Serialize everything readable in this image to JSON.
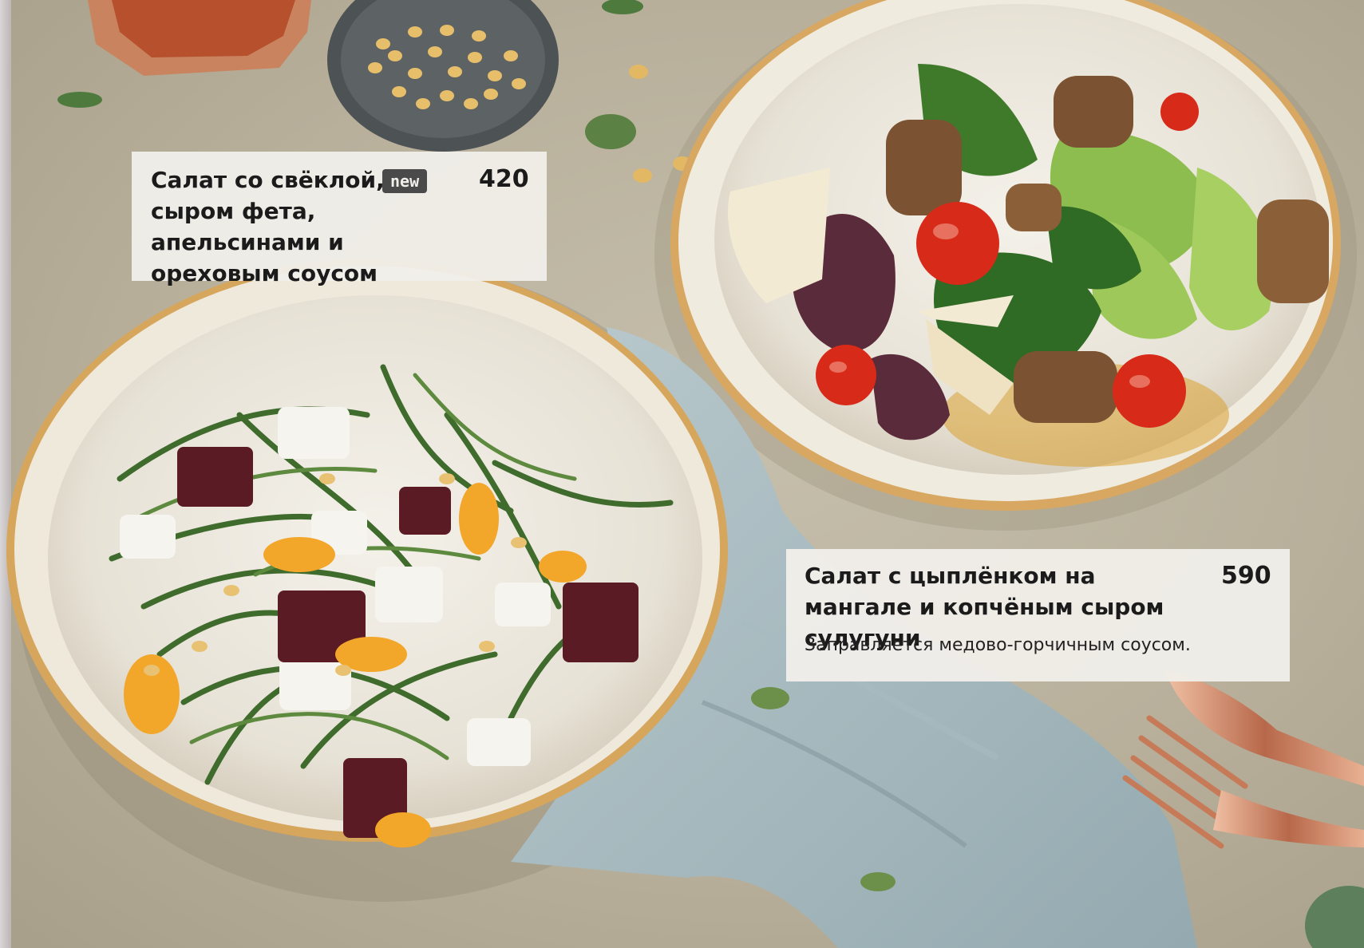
{
  "dishes": [
    {
      "title": "Салат со свёклой, сыром фета, апельсинами и ореховым соусом",
      "badge": "new",
      "price": "420"
    },
    {
      "title": "Салат с цыплёнком на мангале и копчёным сыром сулугуни",
      "price": "590",
      "description": "Заправляется медово-горчичным соусом."
    }
  ],
  "colors": {
    "table": "#bcb4a0",
    "card": "#f0eee9",
    "badge": "#4a4a4a",
    "text": "#1b1b1b"
  }
}
